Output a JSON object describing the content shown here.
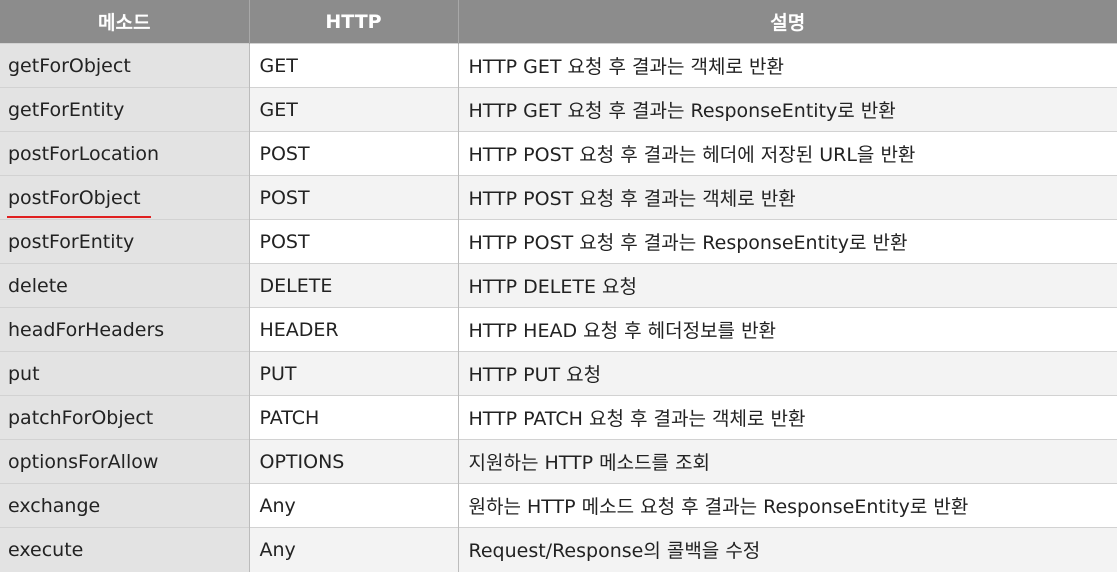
{
  "table": {
    "headers": [
      "메소드",
      "HTTP",
      "설명"
    ],
    "rows": [
      {
        "method": "getForObject",
        "http": "GET",
        "desc": "HTTP GET 요청 후 결과는 객체로 반환"
      },
      {
        "method": "getForEntity",
        "http": "GET",
        "desc": "HTTP GET 요청 후 결과는 ResponseEntity로 반환"
      },
      {
        "method": "postForLocation",
        "http": "POST",
        "desc": "HTTP POST 요청 후 결과는 헤더에 저장된 URL을 반환"
      },
      {
        "method": "postForObject",
        "http": "POST",
        "desc": "HTTP POST 요청 후 결과는 객체로 반환",
        "highlight": "red-underline",
        "highlight_color": "#e02020"
      },
      {
        "method": "postForEntity",
        "http": "POST",
        "desc": "HTTP POST 요청 후 결과는 ResponseEntity로 반환"
      },
      {
        "method": "delete",
        "http": "DELETE",
        "desc": "HTTP DELETE 요청"
      },
      {
        "method": "headForHeaders",
        "http": "HEADER",
        "desc": "HTTP HEAD 요청 후 헤더정보를 반환"
      },
      {
        "method": "put",
        "http": "PUT",
        "desc": "HTTP PUT 요청"
      },
      {
        "method": "patchForObject",
        "http": "PATCH",
        "desc": "HTTP PATCH 요청 후 결과는 객체로 반환"
      },
      {
        "method": "optionsForAllow",
        "http": "OPTIONS",
        "desc": "지원하는 HTTP 메소드를 조회"
      },
      {
        "method": "exchange",
        "http": "Any",
        "desc": "원하는 HTTP 메소드 요청 후 결과는 ResponseEntity로 반환"
      },
      {
        "method": "execute",
        "http": "Any",
        "desc": "Request/Response의 콜백을 수정"
      }
    ]
  },
  "colors": {
    "header_bg": "#8c8c8c",
    "method_col_bg": "#e3e3e3",
    "alt_row_bg": "#f3f3f3",
    "highlight": "#e02020"
  }
}
